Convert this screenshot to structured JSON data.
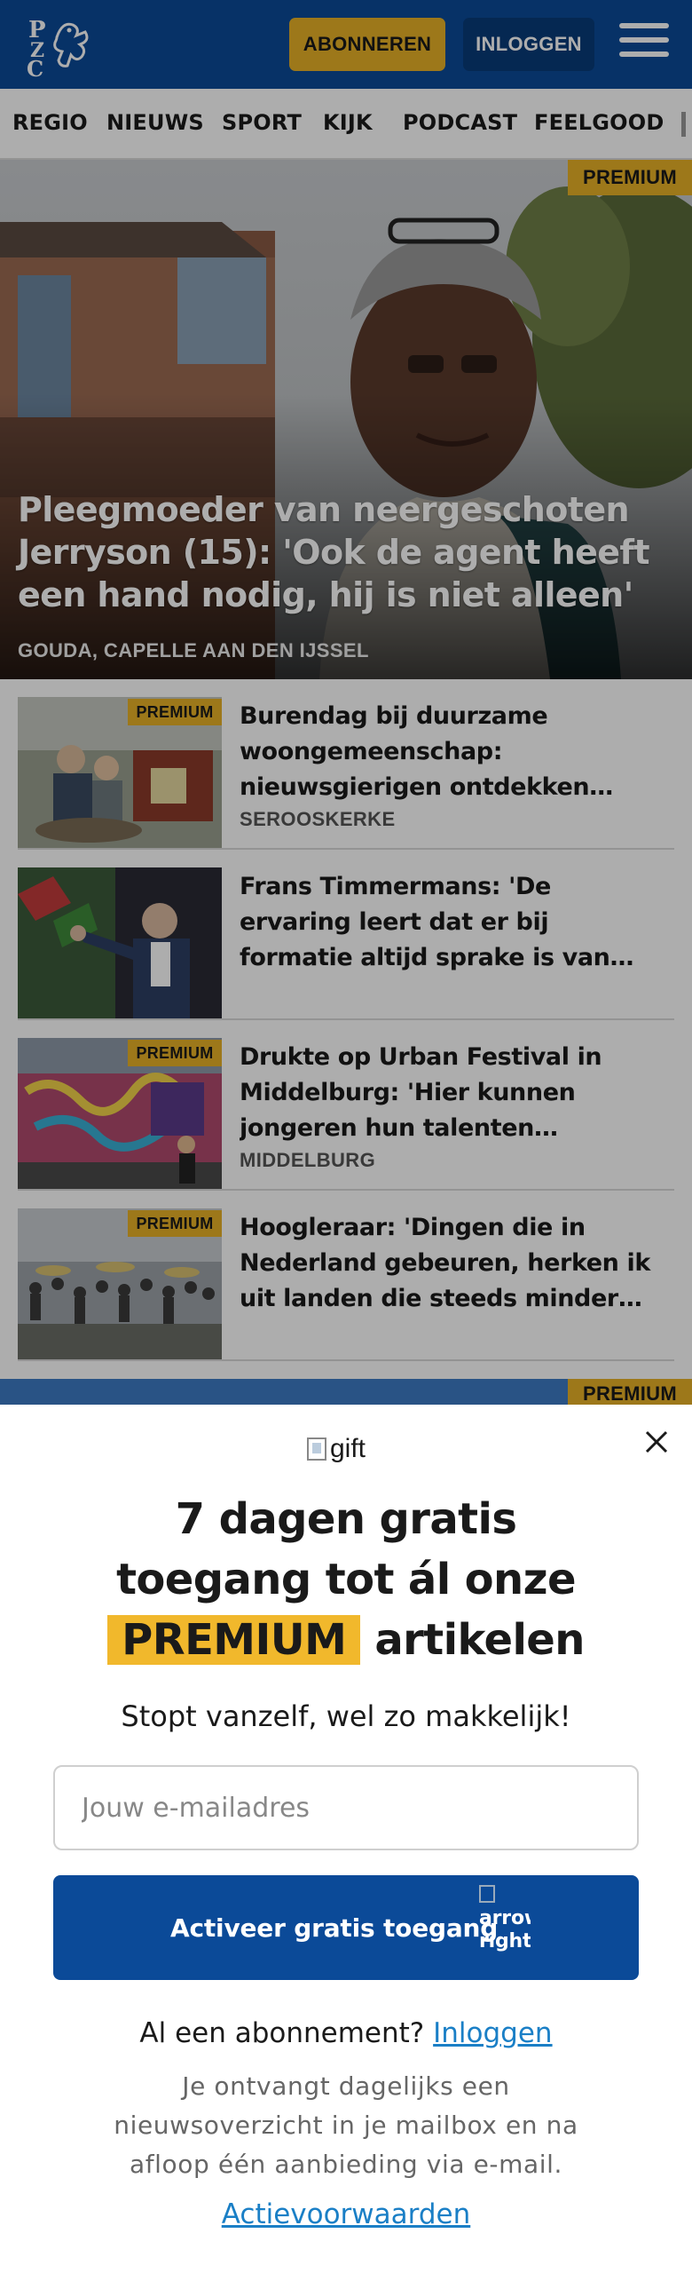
{
  "header": {
    "logo_alt": "PZC",
    "subscribe_label": "ABONNEREN",
    "login_label": "INLOGGEN",
    "menu_icon": "hamburger-icon",
    "brand_color": "#0b4a98",
    "accent_color": "#e8b227"
  },
  "nav": {
    "items": [
      "REGIO",
      "NIEUWS",
      "SPORT",
      "KIJK",
      "PODCAST",
      "FEELGOOD"
    ]
  },
  "hero": {
    "badge": "PREMIUM",
    "title": "Pleegmoeder van neergeschoten Jerryson (15): 'Ook de agent heeft een hand nodig, hij is niet alleen'",
    "location": "GOUDA, CAPELLE AAN DEN IJSSEL"
  },
  "articles": [
    {
      "badge": "PREMIUM",
      "title": "Burendag bij duurzame woongemeenschap: nieuwsgierigen ontdekken wonen en delen in ...",
      "location": "SEROOSKERKE"
    },
    {
      "badge": "",
      "title": "Frans Timmermans: 'De ervaring leert dat er bij formatie altijd sprake is van rechts kluitjesvoetbal'",
      "location": ""
    },
    {
      "badge": "PREMIUM",
      "title": "Drukte op Urban Festival in Middelburg: 'Hier kunnen jongeren hun talenten ontwikkelen'",
      "location": "MIDDELBURG"
    },
    {
      "badge": "PREMIUM",
      "title": "Hoogleraar: 'Dingen die in Nederland gebeuren, herken ik uit landen die steeds minder democratisch zijn'",
      "location": ""
    }
  ],
  "next_article": {
    "badge": "PREMIUM"
  },
  "modal": {
    "gift_alt": "gift",
    "headline_line1": "7 dagen gratis",
    "headline_line2": "toegang tot ál onze",
    "headline_highlight": "PREMIUM",
    "headline_line3_rest": "artikelen",
    "subheadline": "Stopt vanzelf, wel zo makkelijk!",
    "email_placeholder": "Jouw e-mailadres",
    "activate_label": "Activeer gratis toegang",
    "arrow_alt": "arrow-right",
    "already_text": "Al een abonnement?",
    "login_link": "Inloggen",
    "info_text": "Je ontvangt dagelijks een nieuwsoverzicht in je mailbox en na afloop één aanbieding via e-mail.",
    "terms_link": "Actievoorwaarden",
    "close_icon": "close-icon"
  }
}
